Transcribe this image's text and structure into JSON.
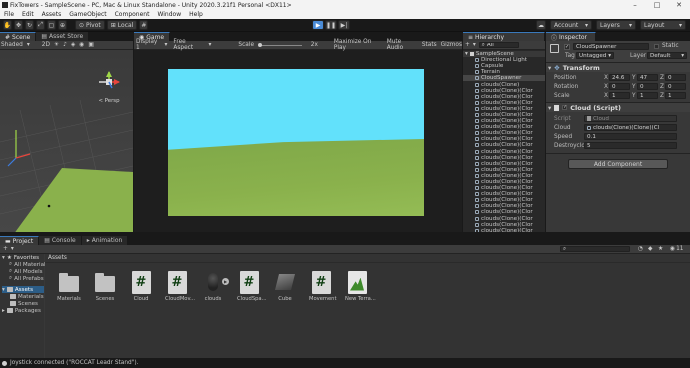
{
  "window": {
    "title": "FixTowers - SampleScene - PC, Mac & Linux Standalone - Unity 2020.3.21f1 Personal <DX11>",
    "minimize_glyph": "–",
    "maximize_glyph": "□",
    "close_glyph": "✕"
  },
  "menu": [
    "File",
    "Edit",
    "Assets",
    "GameObject",
    "Component",
    "Window",
    "Help"
  ],
  "toolbar": {
    "pivot": "Pivot",
    "local": "Local",
    "account": "Account",
    "layers": "Layers",
    "layout": "Layout"
  },
  "scene": {
    "tab_scene": "Scene",
    "tab_asset_store": "Asset Store",
    "shading": "Shaded",
    "mode_2d": "2D",
    "persp": "< Persp"
  },
  "game": {
    "tab": "Game",
    "display": "Display 1",
    "aspect": "Free Aspect",
    "scale_label": "Scale",
    "scale_value": "2x",
    "maximize": "Maximize On Play",
    "mute": "Mute Audio",
    "stats": "Stats",
    "gizmos": "Gizmos"
  },
  "hierarchy": {
    "tab": "Hierarchy",
    "add": "+",
    "search": "All",
    "scene_name": "SampleScene",
    "items": [
      "Directional Light",
      "Capsule",
      "Terrain",
      "CloudSpawner",
      "clouds(Clone)",
      "clouds(Clone)(Clor",
      "clouds(Clone)(Clor",
      "clouds(Clone)(Clor",
      "clouds(Clone)(Clor",
      "clouds(Clone)(Clor",
      "clouds(Clone)(Clor",
      "clouds(Clone)(Clor",
      "clouds(Clone)(Clor",
      "clouds(Clone)(Clor",
      "clouds(Clone)(Clor",
      "clouds(Clone)(Clor",
      "clouds(Clone)(Clor",
      "clouds(Clone)(Clor",
      "clouds(Clone)(Clor",
      "clouds(Clone)(Clor",
      "clouds(Clone)(Clor",
      "clouds(Clone)(Clor",
      "clouds(Clone)(Clor",
      "clouds(Clone)(Clor",
      "clouds(Clone)(Clor",
      "clouds(Clone)(Clor",
      "clouds(Clone)(Clor",
      "clouds(Clone)(Clor",
      "clouds(Clone)(Clor",
      "clouds(Clone)(Clor",
      "clouds(Clone)(Clor",
      "clouds(Clone)(Clor"
    ]
  },
  "inspector": {
    "tab": "Inspector",
    "object_name": "CloudSpawner",
    "static": "Static",
    "tag_label": "Tag",
    "tag_value": "Untagged",
    "layer_label": "Layer",
    "layer_value": "Default",
    "transform": {
      "title": "Transform",
      "rows": [
        {
          "label": "Position",
          "x": "24.6",
          "y": "47",
          "z": "0"
        },
        {
          "label": "Rotation",
          "x": "0",
          "y": "0",
          "z": "0"
        },
        {
          "label": "Scale",
          "x": "1",
          "y": "1",
          "z": "1"
        }
      ]
    },
    "script_component": {
      "title": "Cloud (Script)",
      "script_label": "Script",
      "script_value": "Cloud",
      "cloud_label": "Cloud",
      "cloud_value": "clouds(Clone)(Clone)(Cl",
      "speed_label": "Speed",
      "speed_value": "0.1",
      "destroy_label": "Destroycloud",
      "destroy_value": "5"
    },
    "add_component": "Add Component",
    "axis_x": "X",
    "axis_y": "Y",
    "axis_z": "Z"
  },
  "project": {
    "tab_project": "Project",
    "tab_console": "Console",
    "tab_animation": "Animation",
    "add": "+",
    "favorites": "Favorites",
    "fav_items": [
      "All Materials",
      "All Models",
      "All Prefabs"
    ],
    "assets_root": "Assets",
    "asset_tree": [
      "Materials",
      "Scenes"
    ],
    "packages": "Packages",
    "breadcrumb": "Assets",
    "count": "11",
    "assets": [
      {
        "label": "Materials",
        "kind": "folder"
      },
      {
        "label": "Scenes",
        "kind": "folder"
      },
      {
        "label": "Cloud",
        "kind": "script"
      },
      {
        "label": "CloudMov...",
        "kind": "script"
      },
      {
        "label": "clouds",
        "kind": "model"
      },
      {
        "label": "CloudSpa...",
        "kind": "script"
      },
      {
        "label": "Cube",
        "kind": "cube"
      },
      {
        "label": "Movement",
        "kind": "script"
      },
      {
        "label": "New Terra...",
        "kind": "terrain"
      }
    ]
  },
  "status": "Joystick connected (\"ROCCAT Leadr Stand\").",
  "colors": {
    "sky": "#62e1fb",
    "ground": "#8ab14c",
    "accent": "#3a79bb",
    "play_active": "#4a8bd6"
  }
}
